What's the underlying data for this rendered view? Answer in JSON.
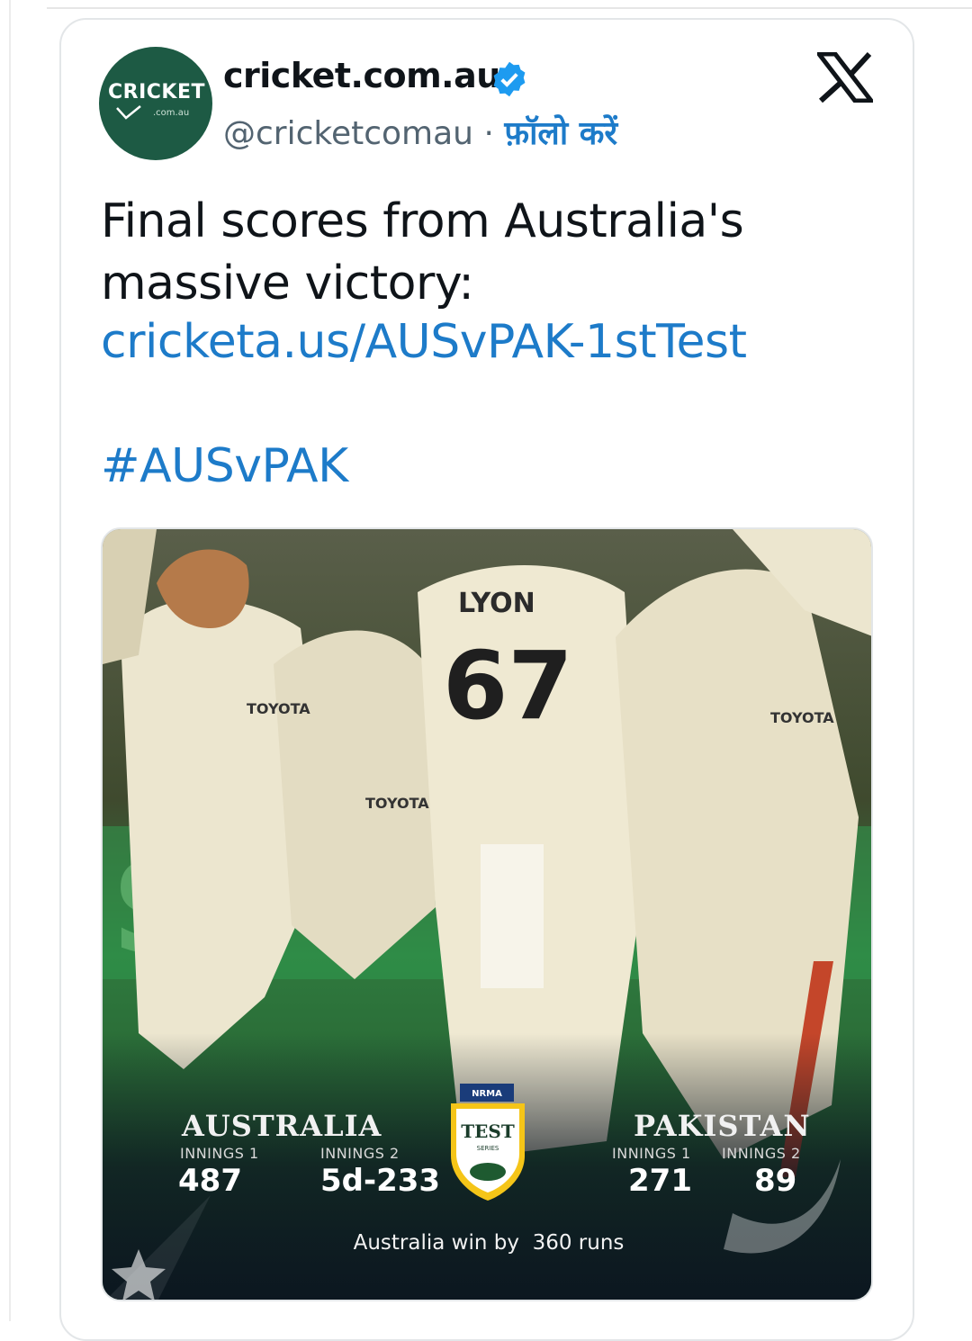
{
  "account": {
    "display_name": "cricket.com.au",
    "handle": "@cricketcomau",
    "separator": "·",
    "follow_label": "फ़ॉलो करें",
    "avatar_text": "CRICKET",
    "avatar_subtext": ".com.au",
    "verified_icon": "verified-badge-icon"
  },
  "platform_icon": "x-logo-icon",
  "tweet": {
    "text": "Final scores from Australia's massive victory:",
    "link": "cricketa.us/AUSvPAK-1stTest",
    "hashtag": "#AUSvPAK"
  },
  "media": {
    "jersey_name": "LYON",
    "jersey_number": "67",
    "sponsor": "TOYOTA",
    "badge_top": "NRMA",
    "badge_main": "TEST",
    "badge_sub": "SERIES",
    "australia": {
      "name": "AUSTRALIA",
      "innings1_label": "INNINGS 1",
      "innings1_score": "487",
      "innings2_label": "INNINGS 2",
      "innings2_score": "5d-233"
    },
    "pakistan": {
      "name": "PAKISTAN",
      "innings1_label": "INNINGS 1",
      "innings1_score": "271",
      "innings2_label": "INNINGS 2",
      "innings2_score": "89"
    },
    "result": "Australia win by  360 runs"
  },
  "colors": {
    "link": "#1d7bc9",
    "avatar_bg": "#1d5a44",
    "text": "#0f1419",
    "secondary_text": "#536471"
  }
}
